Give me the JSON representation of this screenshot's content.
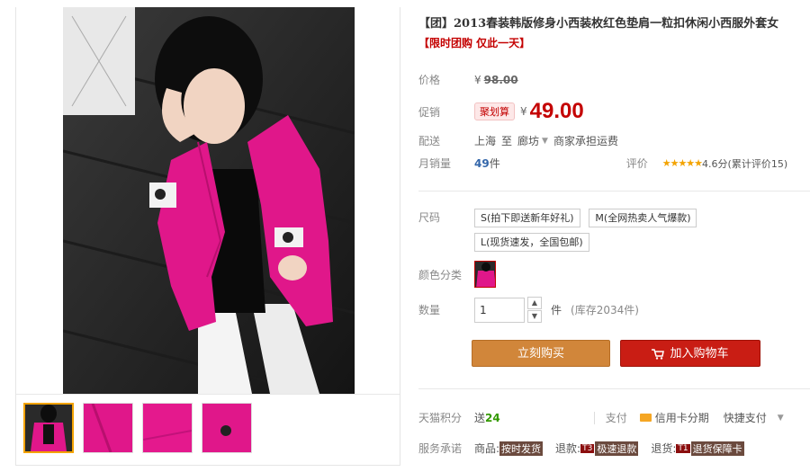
{
  "product": {
    "title": "【团】2013春装韩版修身小西装枚红色垫肩一粒扣休闲小西服外套女",
    "subtitle": "【限时团购 仅此一天】"
  },
  "pricing": {
    "original_label": "价格",
    "currency": "¥",
    "original_price": "98.00",
    "promo_label": "促销",
    "promo_badge": "聚划算",
    "promo_price": "49.00"
  },
  "shipping": {
    "label": "配送",
    "from": "上海",
    "to_word": "至",
    "to": "廊坊",
    "fee": "商家承担运费"
  },
  "sales": {
    "label": "月销量",
    "count": "49",
    "unit": "件",
    "rating_label": "评价",
    "stars": "★★★★★",
    "rating": "4.6分(累计评价15)"
  },
  "options": {
    "size_label": "尺码",
    "sizes": [
      "S(拍下即送新年好礼)",
      "M(全网热卖人气爆款)",
      "L(现货速发，全国包邮)"
    ],
    "color_label": "颜色分类"
  },
  "quantity": {
    "label": "数量",
    "value": "1",
    "unit": "件",
    "stock": "(库存2034件)",
    "up_arrow": "▲",
    "down_arrow": "▼"
  },
  "actions": {
    "buy_now": "立刻购买",
    "add_to_cart": "加入购物车"
  },
  "points": {
    "label": "天猫积分",
    "prefix": "送",
    "value": "24",
    "pay_label": "支付",
    "card_pay": "信用卡分期",
    "quick_pay": "快捷支付"
  },
  "service": {
    "label": "服务承诺",
    "goods_label": "商品:",
    "goods_tag": "按时发货",
    "refund_label": "退款:",
    "refund_tag_code": "T3",
    "refund_tag": "极速退款",
    "return_label": "退货:",
    "return_tag_code": "T1",
    "return_tag": "退货保障卡"
  },
  "colors": {
    "accent": "#c40000",
    "buy_button": "#d1863a",
    "cart_button": "#c91d14",
    "product": "#e0178a"
  }
}
